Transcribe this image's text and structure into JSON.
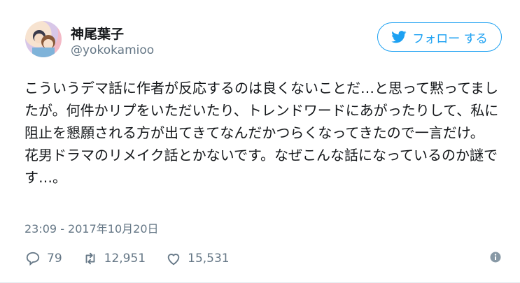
{
  "user": {
    "display_name": "神尾葉子",
    "screen_name": "@yokokamioo"
  },
  "follow_button": {
    "label": "フォロー する"
  },
  "tweet": {
    "text": "こういうデマ話に作者が反応するのは良くないことだ…と思って黙ってましたが。何件かリプをいただいたり、トレンドワードにあがったりして、私に阻止を懇願される方が出てきてなんだかつらくなってきたので一言だけ。\n花男ドラマのリメイク話とかないです。なぜこんな話になっているのか謎です…。",
    "timestamp": "23:09 - 2017年10月20日"
  },
  "actions": {
    "replies": "79",
    "retweets": "12,951",
    "likes": "15,531"
  },
  "icons": {
    "follow": "twitter-bird-icon",
    "reply": "reply-icon",
    "retweet": "retweet-icon",
    "like": "heart-icon",
    "info": "info-icon"
  },
  "colors": {
    "accent": "#1da1f2",
    "muted": "#657786",
    "text": "#14171a"
  }
}
